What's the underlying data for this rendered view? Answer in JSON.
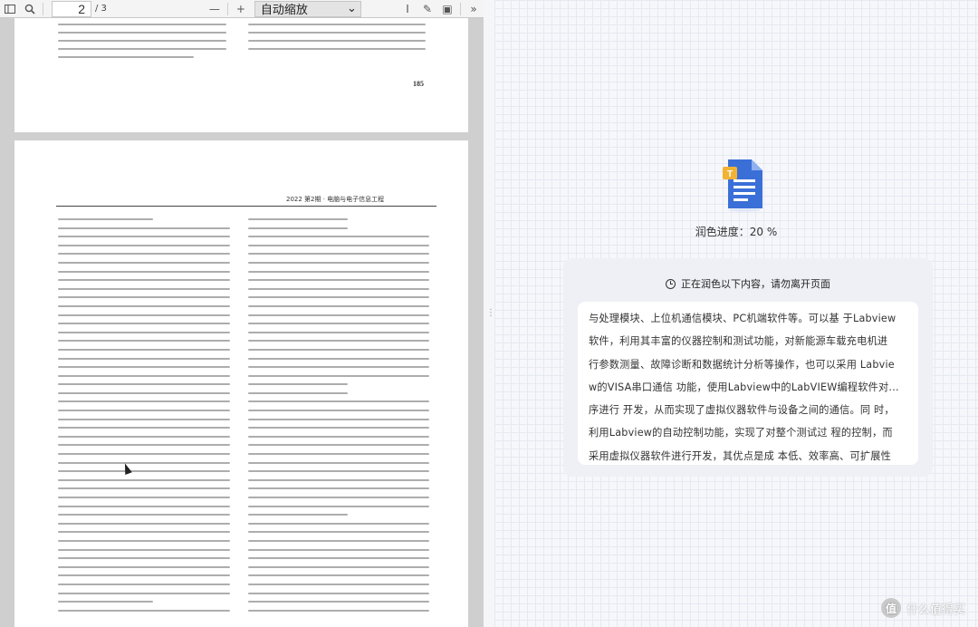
{
  "viewer": {
    "toolbar": {
      "sidebar_toggle_icon": "sidebar-toggle-icon",
      "search_icon": "search-icon",
      "page_current": "2",
      "page_total": "/ 3",
      "zoom_out": "—",
      "zoom_in": "+",
      "zoom_value": "自动缩放",
      "dropdown_icon": "⌄",
      "text_tool_icon": "I",
      "draw_icon": "✎",
      "image_icon": "▣",
      "print_icon": "⎙",
      "more_icon": "»"
    },
    "page_a": {
      "page_number": "185"
    },
    "page_b": {
      "running_head": "2022 第2期 · 电脑与电子信息工程"
    }
  },
  "panel": {
    "progress_label": "润色进度：20 %",
    "card_header": "正在润色以下内容，请勿离开页面",
    "card_lines": [
      "与处理模块、上位机通信模块、PC机端软件等。可以基 于Labview",
      "软件，利用其丰富的仪器控制和测试功能，对新能源车载充电机进",
      "行参数测量、故障诊断和数据统计分析等操作，也可以采用 Labvie",
      "w的VISA串口通信 功能，使用Labview中的LabVIEW编程软件对...",
      "序进行 开发，从而实现了虚拟仪器软件与设备之间的通信。同 时，",
      "利用Labview的自动控制功能，实现了对整个测试过 程的控制，而",
      "采用虚拟仪器软件进行开发，其优点是成 本低、效率高、可扩展性"
    ],
    "watermark": "什么值得买",
    "watermark_logo": "值"
  },
  "colors": {
    "accent": "#3b6fd8",
    "doc_yellow": "#f2b233"
  }
}
